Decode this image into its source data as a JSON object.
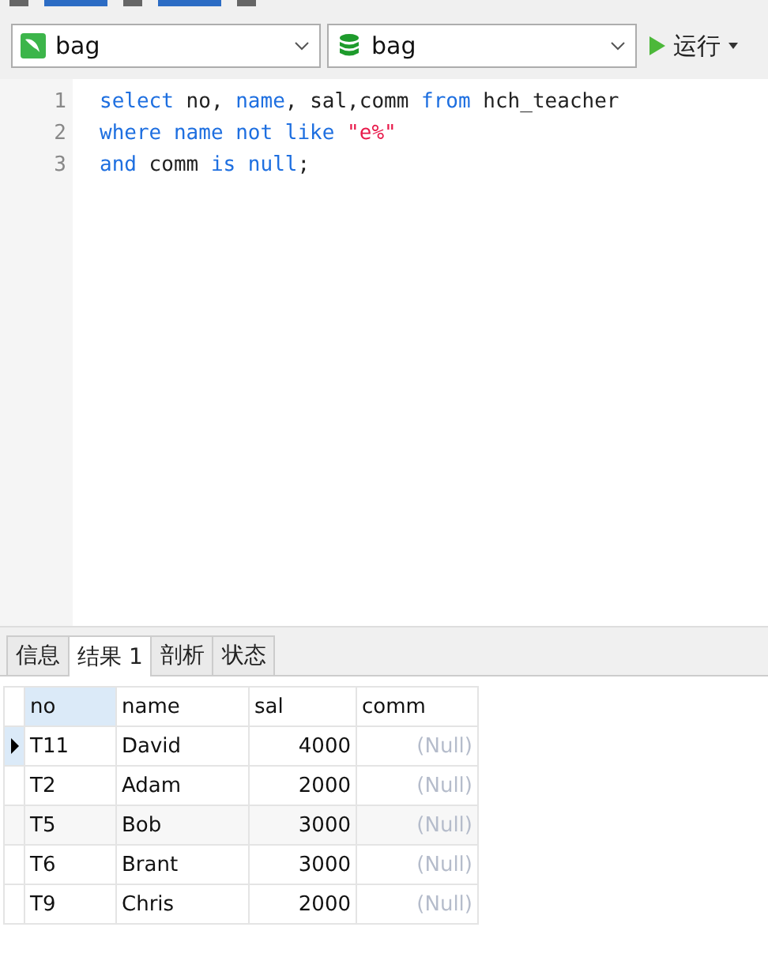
{
  "connection_select": {
    "value": "bag"
  },
  "database_select": {
    "value": "bag"
  },
  "run_button": {
    "label": "运行"
  },
  "editor": {
    "lines": [
      {
        "number": "1",
        "tokens": [
          {
            "text": "select",
            "kind": "keyword"
          },
          {
            "text": " no, ",
            "kind": "ident"
          },
          {
            "text": "name",
            "kind": "keyword"
          },
          {
            "text": ", sal,comm ",
            "kind": "ident"
          },
          {
            "text": "from",
            "kind": "keyword"
          },
          {
            "text": " hch_teacher",
            "kind": "ident"
          }
        ]
      },
      {
        "number": "2",
        "tokens": [
          {
            "text": "where name not like ",
            "kind": "keyword"
          },
          {
            "text": "\"e%\"",
            "kind": "string"
          }
        ]
      },
      {
        "number": "3",
        "tokens": [
          {
            "text": "and",
            "kind": "keyword"
          },
          {
            "text": " comm ",
            "kind": "ident"
          },
          {
            "text": "is null",
            "kind": "keyword"
          },
          {
            "text": ";",
            "kind": "ident"
          }
        ]
      }
    ]
  },
  "result_tabs": [
    {
      "label": "信息",
      "selected": false
    },
    {
      "label": "结果 1",
      "selected": true
    },
    {
      "label": "剖析",
      "selected": false
    },
    {
      "label": "状态",
      "selected": false
    }
  ],
  "table": {
    "columns": [
      {
        "label": "no",
        "selected": true,
        "kind": "text"
      },
      {
        "label": "name",
        "selected": false,
        "kind": "text"
      },
      {
        "label": "sal",
        "selected": false,
        "kind": "number"
      },
      {
        "label": "comm",
        "selected": false,
        "kind": "number"
      }
    ],
    "rows": [
      {
        "selected": true,
        "cells": [
          {
            "text": "T11",
            "null": false
          },
          {
            "text": "David",
            "null": false
          },
          {
            "text": "4000",
            "null": false
          },
          {
            "text": "(Null)",
            "null": true
          }
        ]
      },
      {
        "selected": false,
        "cells": [
          {
            "text": "T2",
            "null": false
          },
          {
            "text": "Adam",
            "null": false
          },
          {
            "text": "2000",
            "null": false
          },
          {
            "text": "(Null)",
            "null": true
          }
        ]
      },
      {
        "selected": false,
        "cells": [
          {
            "text": "T5",
            "null": false
          },
          {
            "text": "Bob",
            "null": false
          },
          {
            "text": "3000",
            "null": false
          },
          {
            "text": "(Null)",
            "null": true
          }
        ]
      },
      {
        "selected": false,
        "cells": [
          {
            "text": "T6",
            "null": false
          },
          {
            "text": "Brant",
            "null": false
          },
          {
            "text": "3000",
            "null": false
          },
          {
            "text": "(Null)",
            "null": true
          }
        ]
      },
      {
        "selected": false,
        "cells": [
          {
            "text": "T9",
            "null": false
          },
          {
            "text": "Chris",
            "null": false
          },
          {
            "text": "2000",
            "null": false
          },
          {
            "text": "(Null)",
            "null": true
          }
        ]
      }
    ]
  }
}
